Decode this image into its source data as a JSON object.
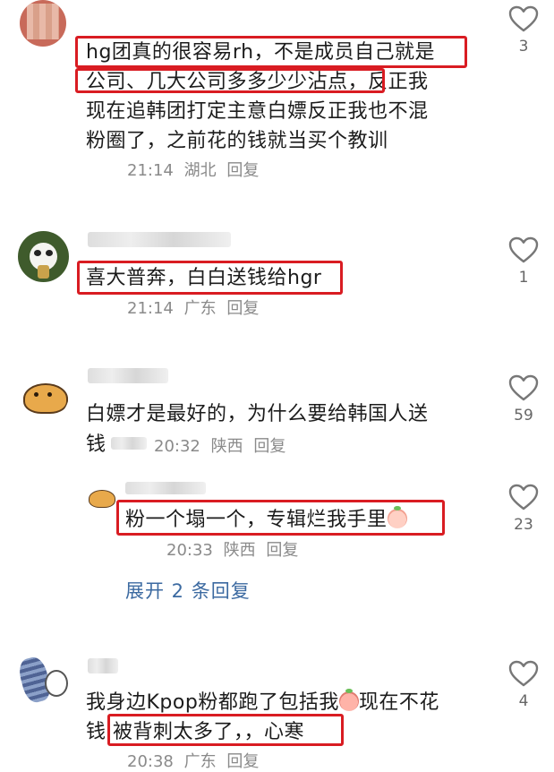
{
  "comments": [
    {
      "text_lines": [
        "hg团真的很容易rh，不是成员自己就是",
        "公司、几大公司多多少少沾点，反正我",
        "现在追韩团打定主意白嫖反正我也不混",
        "粉圈了，之前花的钱就当买个教训"
      ],
      "time": "21:14",
      "location": "湖北",
      "reply_label": "回复",
      "like_count": "3"
    },
    {
      "text": "喜大普奔，白白送钱给hgr",
      "time": "21:14",
      "location": "广东",
      "reply_label": "回复",
      "like_count": "1"
    },
    {
      "text_line1": "白嫖才是最好的，为什么要给韩国人送",
      "text_line2": "钱",
      "time": "20:32",
      "location": "陕西",
      "reply_label": "回复",
      "like_count": "59"
    },
    {
      "text": "粉一个塌一个，专辑烂我手里",
      "time": "20:33",
      "location": "陕西",
      "reply_label": "回复",
      "like_count": "23"
    },
    {
      "text_line1a": "我身边Kpop粉都跑了包括我",
      "text_line1b": "现在不花",
      "text_line2a": "钱",
      "text_line2b": "被背刺太多了，，心寒",
      "time": "20:38",
      "location": "广东",
      "reply_label": "回复",
      "like_count": "4"
    }
  ],
  "expand_replies": "展开 2 条回复",
  "colors": {
    "highlight": "#d91c22",
    "link": "#3c6aa1",
    "meta": "#8a8a8a"
  },
  "icons": {
    "like": "heart-outline-icon"
  }
}
